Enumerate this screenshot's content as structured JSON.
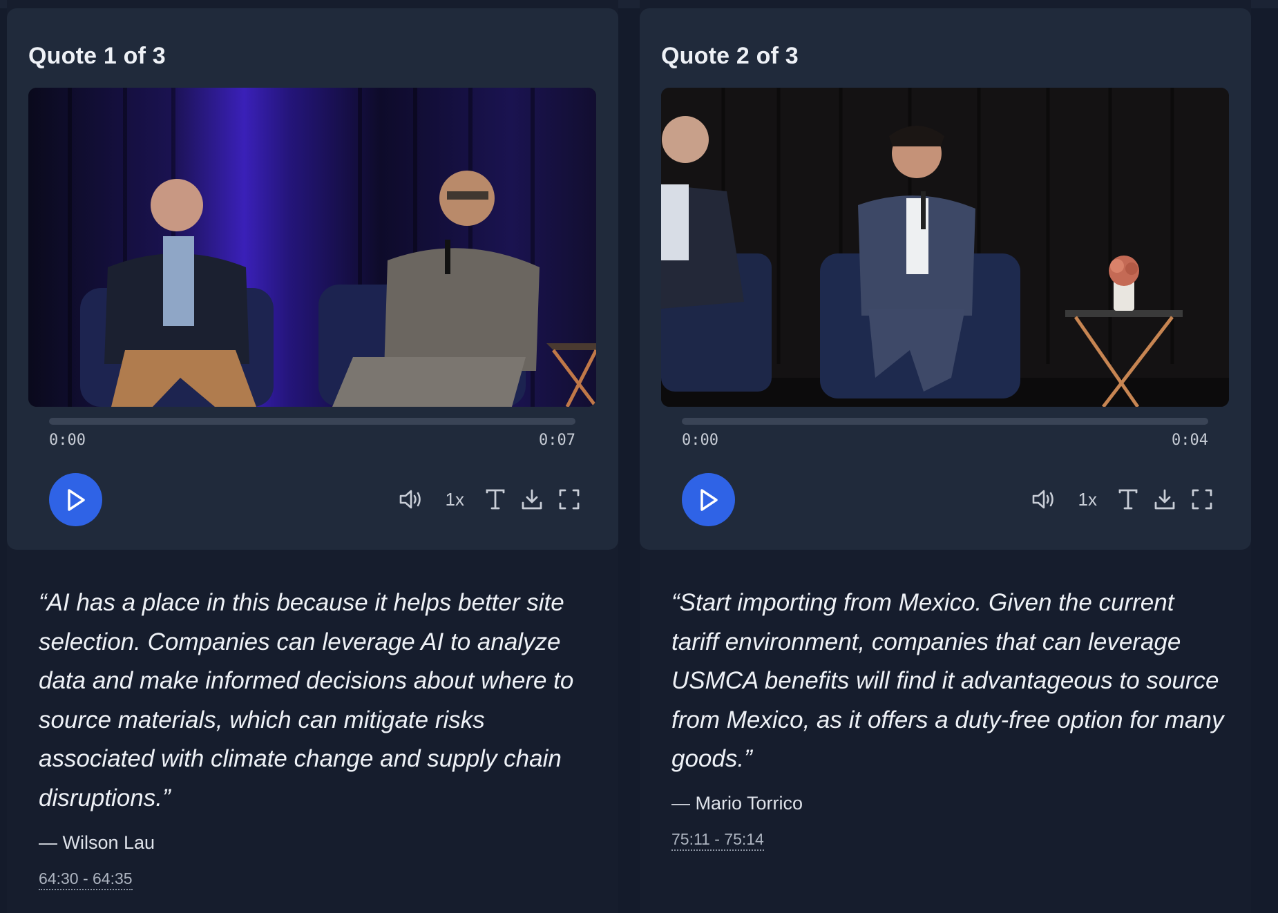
{
  "colors": {
    "page_bg": "#141b2b",
    "card_bg": "#202a3b",
    "play_button": "#2f63e6",
    "text_primary": "#eef1f6",
    "text_secondary": "#c9ced7"
  },
  "quotes": [
    {
      "card_title": "Quote 1 of 3",
      "video": {
        "scene": "two-speakers-purple-curtain",
        "time_current": "0:00",
        "time_total": "0:07",
        "progress": 0,
        "speed": "1x"
      },
      "text": "“AI has a place in this because it helps better site selection. Companies can leverage AI to analyze data and make informed decisions about where to source materials, which can mitigate risks associated with climate change and supply chain disruptions.”",
      "author": "— Wilson Lau",
      "timestamp": "64:30 - 64:35"
    },
    {
      "card_title": "Quote 2 of 3",
      "video": {
        "scene": "speaker-with-microphone-dark-curtain",
        "time_current": "0:00",
        "time_total": "0:04",
        "progress": 0,
        "speed": "1x"
      },
      "text": "“Start importing from Mexico. Given the current tariff environment, companies that can leverage USMCA benefits will find it advantageous to source from Mexico, as it offers a duty-free option for many goods.”",
      "author": "— Mario Torrico",
      "timestamp": "75:11 - 75:14"
    }
  ],
  "icons": {
    "play": "play-icon",
    "volume": "volume-icon",
    "captions": "captions-icon",
    "download": "download-icon",
    "fullscreen": "fullscreen-icon"
  }
}
